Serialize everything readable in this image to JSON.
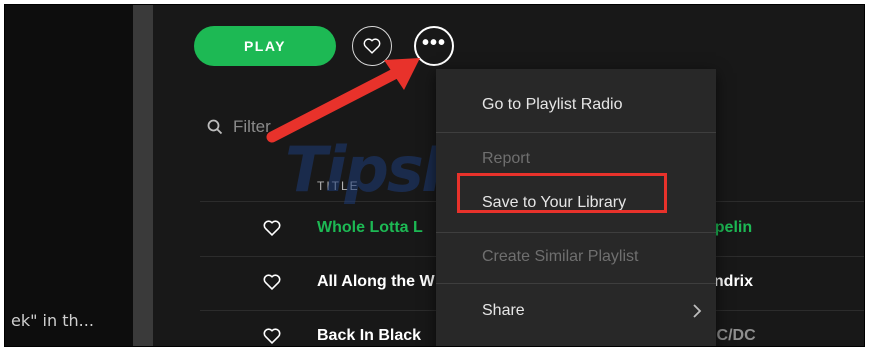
{
  "toolbar": {
    "play_label": "PLAY",
    "heart_icon": "heart-outline-icon",
    "more_icon": "more-options-icon",
    "more_glyph": "•••"
  },
  "filter": {
    "placeholder": "Filter",
    "icon": "search-icon"
  },
  "tracklist": {
    "title_header": "TITLE",
    "rows": [
      {
        "title": "Whole Lotta L",
        "artist": "ppelin",
        "color": "#1db954"
      },
      {
        "title": "All Along the W",
        "artist": "endrix",
        "color": "#ffffff"
      },
      {
        "title": "Back In Black",
        "artist": "AC/DC",
        "color": "#ffffff"
      }
    ]
  },
  "sidebar": {
    "truncated_text": "ek\" in th..."
  },
  "context_menu": {
    "items": [
      {
        "label": "Go to Playlist Radio",
        "enabled": true
      },
      {
        "label": "Report",
        "enabled": false
      },
      {
        "label": "Save to Your Library",
        "enabled": true,
        "highlighted": true
      },
      {
        "label": "Create Similar Playlist",
        "enabled": false
      },
      {
        "label": "Share",
        "enabled": true,
        "submenu": true
      }
    ]
  },
  "annotation": {
    "arrow_color": "#e8322b",
    "watermark": "TipsMake"
  },
  "colors": {
    "accent": "#1db954",
    "background": "#181818",
    "menu_bg": "#282828"
  }
}
